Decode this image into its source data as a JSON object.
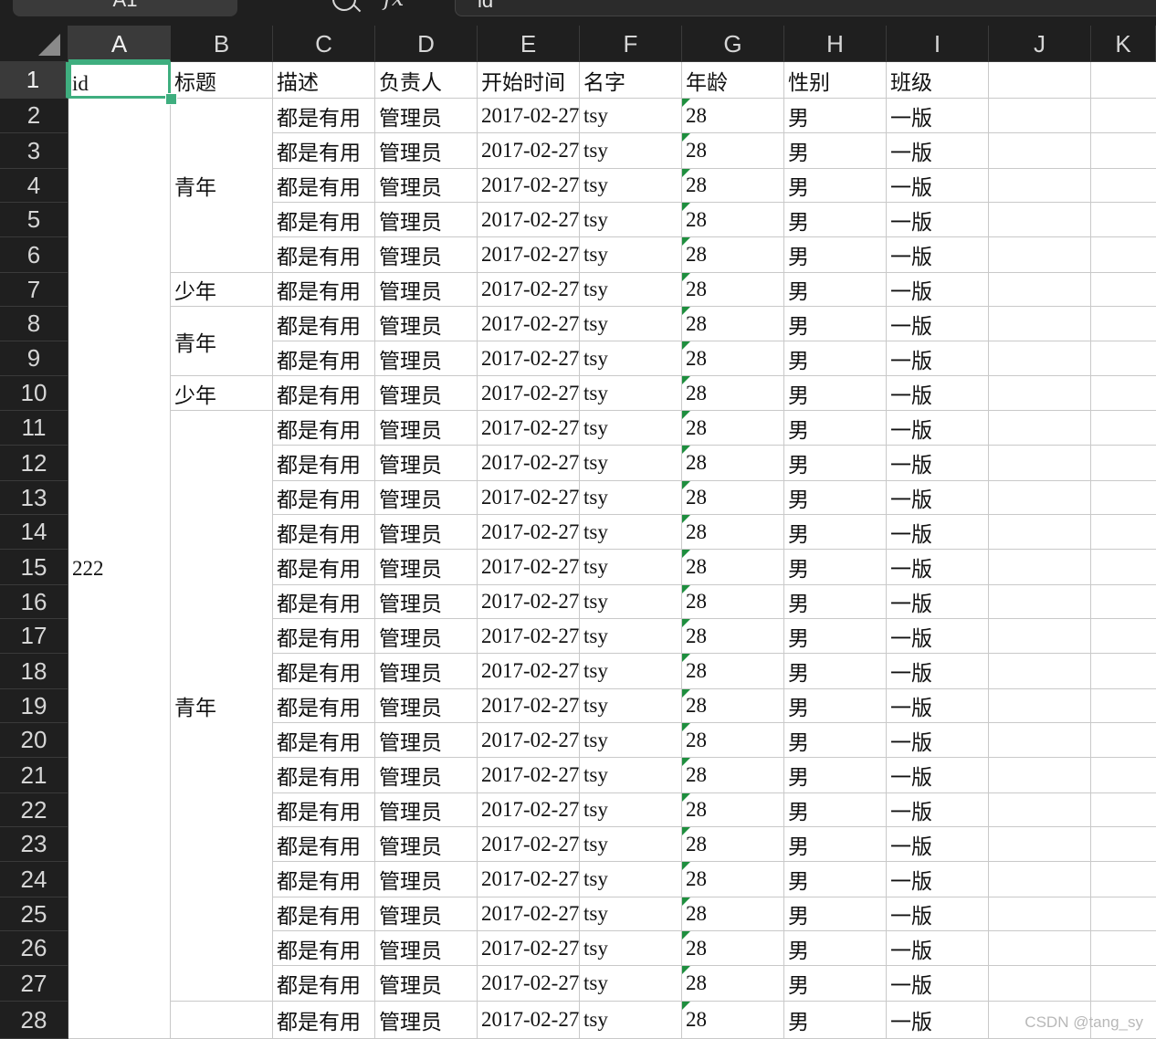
{
  "toolbar": {
    "name_box": "A1",
    "formula": "id"
  },
  "columns": [
    "A",
    "B",
    "C",
    "D",
    "E",
    "F",
    "G",
    "H",
    "I",
    "J",
    "K"
  ],
  "selected_cell": "A1",
  "header_row": [
    "id",
    "标题",
    "描述",
    "负责人",
    "开始时间",
    "名字",
    "年龄",
    "性别",
    "班级"
  ],
  "merged_cells": [
    {
      "col": "A",
      "from_row": 2,
      "to_row": 28,
      "value": "222"
    },
    {
      "col": "B",
      "from_row": 2,
      "to_row": 6,
      "value": "青年"
    },
    {
      "col": "B",
      "from_row": 7,
      "to_row": 7,
      "value": "少年"
    },
    {
      "col": "B",
      "from_row": 8,
      "to_row": 9,
      "value": "青年"
    },
    {
      "col": "B",
      "from_row": 10,
      "to_row": 10,
      "value": "少年"
    },
    {
      "col": "B",
      "from_row": 11,
      "to_row": 27,
      "value": "青年"
    },
    {
      "col": "B",
      "from_row": 28,
      "to_row": 28,
      "value": ""
    }
  ],
  "row_template": {
    "描述": "都是有用",
    "负责人": "管理员",
    "开始时间": "2017-02-27",
    "名字": "tsy",
    "年龄": "28",
    "性别": "男",
    "班级": "一版"
  },
  "row_numbers": [
    1,
    2,
    3,
    4,
    5,
    6,
    7,
    8,
    9,
    10,
    11,
    12,
    13,
    14,
    15,
    16,
    17,
    18,
    19,
    20,
    21,
    22,
    23,
    24,
    25,
    26,
    27,
    28
  ],
  "number_stored_as_text_indicator_color": "#1e8e3e",
  "selection_color": "#3fae7f",
  "watermark": "CSDN @tang_sy"
}
